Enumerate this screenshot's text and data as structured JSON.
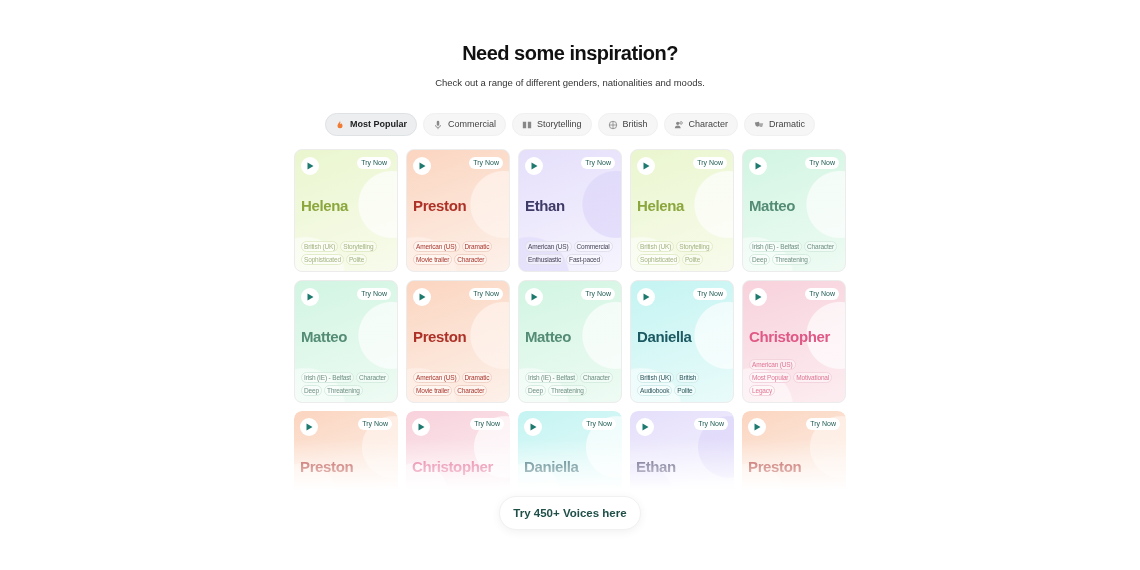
{
  "heading": "Need some inspiration?",
  "subheading": "Check out a range of different genders, nationalities and moods.",
  "tabs": [
    {
      "label": "Most Popular",
      "selected": true
    },
    {
      "label": "Commercial",
      "selected": false
    },
    {
      "label": "Storytelling",
      "selected": false
    },
    {
      "label": "British",
      "selected": false
    },
    {
      "label": "Character",
      "selected": false
    },
    {
      "label": "Dramatic",
      "selected": false
    }
  ],
  "cards": [
    {
      "name": "Helena",
      "kind": "lime",
      "action": "Try Now",
      "tags": [
        "British (UK)",
        "Storytelling",
        "Sophisticated",
        "Polite"
      ]
    },
    {
      "name": "Preston",
      "kind": "orange",
      "action": "Try Now",
      "tags": [
        "American (US)",
        "Dramatic",
        "Movie trailer",
        "Character"
      ]
    },
    {
      "name": "Ethan",
      "kind": "purple",
      "action": "Try Now",
      "tags": [
        "American (US)",
        "Commercial",
        "Enthusiastic",
        "Fast-paced"
      ]
    },
    {
      "name": "Helena",
      "kind": "lime",
      "action": "Try Now",
      "tags": [
        "British (UK)",
        "Storytelling",
        "Sophisticated",
        "Polite"
      ]
    },
    {
      "name": "Matteo",
      "kind": "mint",
      "action": "Try Now",
      "tags": [
        "Irish (IE) - Belfast",
        "Character",
        "Deep",
        "Threatening"
      ]
    },
    {
      "name": "Matteo",
      "kind": "mint",
      "action": "Try Now",
      "tags": [
        "Irish (IE) - Belfast",
        "Character",
        "Deep",
        "Threatening"
      ]
    },
    {
      "name": "Preston",
      "kind": "orange",
      "action": "Try Now",
      "tags": [
        "American (US)",
        "Dramatic",
        "Movie trailer",
        "Character"
      ]
    },
    {
      "name": "Matteo",
      "kind": "mint",
      "action": "Try Now",
      "tags": [
        "Irish (IE) - Belfast",
        "Character",
        "Deep",
        "Threatening"
      ]
    },
    {
      "name": "Daniella",
      "kind": "cyan",
      "action": "Try Now",
      "tags": [
        "British (UK)",
        "British",
        "Audiobook",
        "Polite"
      ]
    },
    {
      "name": "Christopher",
      "kind": "pink",
      "action": "Try Now",
      "tags": [
        "American (US)",
        "Most Popular",
        "Motivational",
        "Legacy"
      ]
    },
    {
      "name": "Preston",
      "kind": "orange",
      "action": "Try Now",
      "faded": true
    },
    {
      "name": "Christopher",
      "kind": "pink",
      "action": "Try Now",
      "faded": true
    },
    {
      "name": "Daniella",
      "kind": "cyan",
      "action": "Try Now",
      "faded": true
    },
    {
      "name": "Ethan",
      "kind": "purple",
      "action": "Try Now",
      "faded": true
    },
    {
      "name": "Preston",
      "kind": "orange",
      "action": "Try Now",
      "faded": true
    }
  ],
  "cta": "Try 450+ Voices here"
}
